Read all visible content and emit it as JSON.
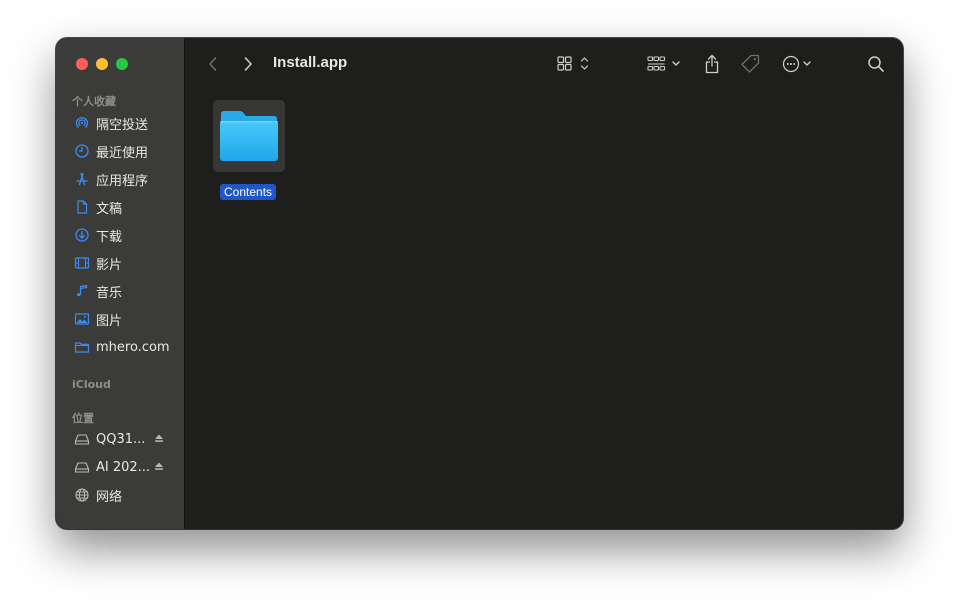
{
  "window": {
    "title": "Install.app"
  },
  "sidebar": {
    "favorites_label": "个人收藏",
    "favorites": [
      {
        "label": "隔空投送",
        "icon": "airdrop-icon"
      },
      {
        "label": "最近使用",
        "icon": "clock-icon"
      },
      {
        "label": "应用程序",
        "icon": "applications-icon"
      },
      {
        "label": "文稿",
        "icon": "document-icon"
      },
      {
        "label": "下载",
        "icon": "download-icon"
      },
      {
        "label": "影片",
        "icon": "film-icon"
      },
      {
        "label": "音乐",
        "icon": "music-icon"
      },
      {
        "label": "图片",
        "icon": "photo-icon"
      },
      {
        "label": "mhero.com",
        "icon": "folder-icon"
      }
    ],
    "icloud_label": "iCloud",
    "locations_label": "位置",
    "locations": [
      {
        "label": "QQ31...",
        "icon": "drive-icon",
        "eject": true
      },
      {
        "label": "AI 202...",
        "icon": "drive-icon",
        "eject": true
      },
      {
        "label": "网络",
        "icon": "globe-icon",
        "eject": false
      }
    ]
  },
  "content": {
    "items": [
      {
        "name": "Contents",
        "icon": "folder-icon",
        "selected": true
      }
    ]
  },
  "colors": {
    "accent": "#2f7bf5",
    "selection": "#1f57c9",
    "sidebar_bg": "#3b3c3a",
    "content_bg": "#1e1f1d",
    "folder": "#38bdf8"
  }
}
